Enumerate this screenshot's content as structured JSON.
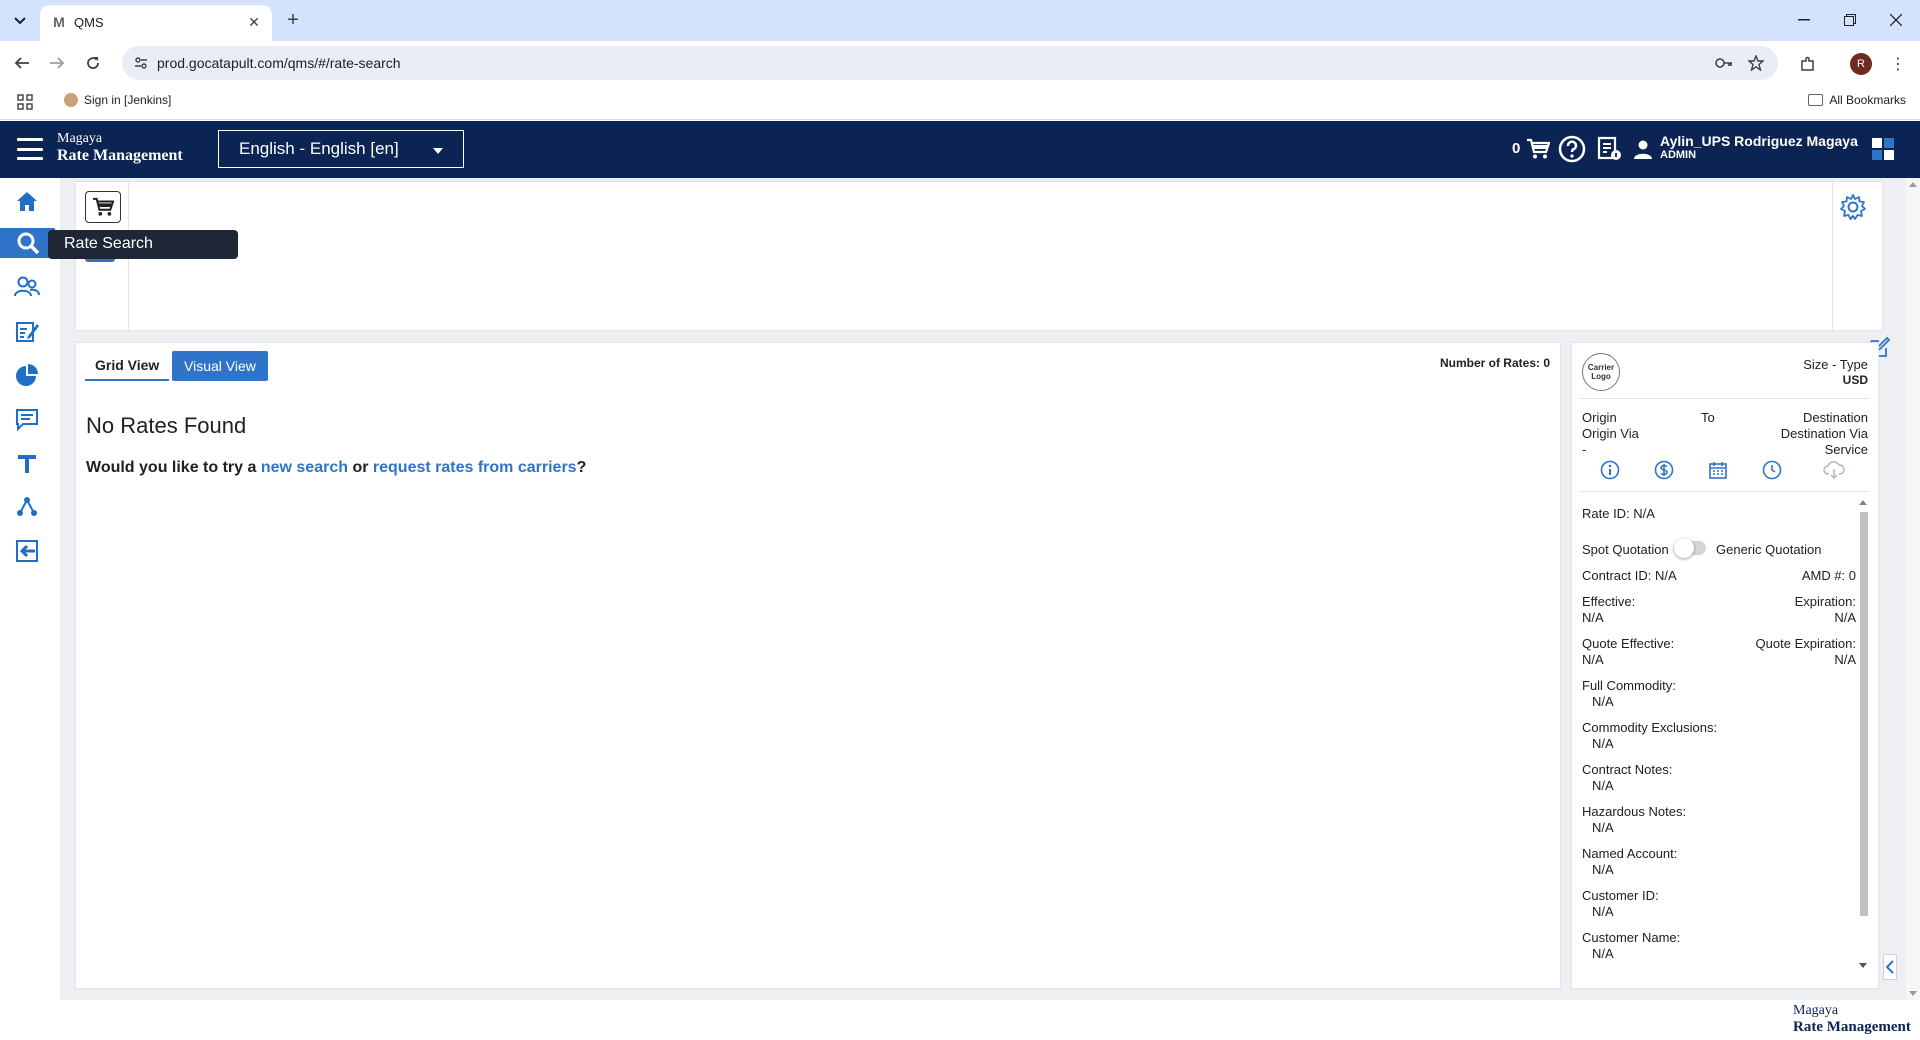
{
  "browser": {
    "tab_title": "QMS",
    "tab_favicon": "M",
    "url": "prod.gocatapult.com/qms/#/rate-search",
    "bookmark_item": "Sign in [Jenkins]",
    "all_bookmarks": "All Bookmarks",
    "profile_initial": "R"
  },
  "header": {
    "brand_top": "Magaya",
    "brand_bottom": "Rate Management",
    "language": "English - English [en]",
    "cart_count": "0",
    "user_name": "Aylin_UPS Rodriguez Magaya",
    "user_role": "ADMIN",
    "accent_color": "#0b2454"
  },
  "nav": {
    "items": [
      "home-icon",
      "search-icon",
      "contacts-icon",
      "edit-list-icon",
      "pie-chart-icon",
      "messages-icon",
      "text-icon",
      "network-icon",
      "logout-icon"
    ],
    "active": "search-icon",
    "tooltip": "Rate Search"
  },
  "results": {
    "tabs": [
      {
        "label": "Grid View",
        "active": false
      },
      {
        "label": "Visual View",
        "active": true
      }
    ],
    "rates_count_label": "Number of Rates: 0",
    "empty_title": "No Rates Found",
    "suggest_prefix": "Would you like to try a",
    "suggest_link1": "new search",
    "suggest_mid": "or",
    "suggest_link2": "request rates from carriers",
    "suggest_suffix": "?"
  },
  "detail": {
    "carrier_logo_line1": "Carrier",
    "carrier_logo_line2": "Logo",
    "size_type": "Size - Type",
    "currency": "USD",
    "origin": "Origin",
    "to": "To",
    "destination": "Destination",
    "origin_via": "Origin Via",
    "destination_via": "Destination Via",
    "dash": "-",
    "service": "Service",
    "rate_id": "Rate ID: N/A",
    "spot_quotation": "Spot Quotation",
    "generic_quotation": "Generic Quotation",
    "contract_id": "Contract ID: N/A",
    "amd": "AMD #: 0",
    "effective_label": "Effective:",
    "effective_value": "N/A",
    "expiration_label": "Expiration:",
    "expiration_value": "N/A",
    "quote_effective_label": "Quote Effective:",
    "quote_effective_value": "N/A",
    "quote_expiration_label": "Quote Expiration:",
    "quote_expiration_value": "N/A",
    "fields": [
      {
        "label": "Full Commodity:",
        "value": "N/A"
      },
      {
        "label": "Commodity Exclusions:",
        "value": "N/A"
      },
      {
        "label": "Contract Notes:",
        "value": "N/A"
      },
      {
        "label": "Hazardous Notes:",
        "value": "N/A"
      },
      {
        "label": "Named Account:",
        "value": "N/A"
      },
      {
        "label": "Customer ID:",
        "value": "N/A"
      },
      {
        "label": "Customer Name:",
        "value": "N/A"
      }
    ]
  },
  "footer": {
    "brand_top": "Magaya",
    "brand_bottom": "Rate Management"
  }
}
